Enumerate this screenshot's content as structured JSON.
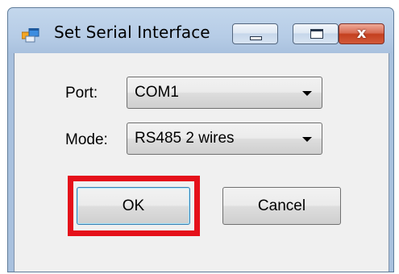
{
  "window": {
    "title": "Set Serial Interface",
    "icon": "app-window-icon",
    "caption_buttons": [
      "minimize-icon",
      "maximize-icon",
      "close-icon"
    ],
    "close_glyph": "x"
  },
  "form": {
    "port": {
      "label": "Port:",
      "value": "COM1"
    },
    "mode": {
      "label": "Mode:",
      "value": "RS485 2 wires"
    }
  },
  "buttons": {
    "ok_label": "OK",
    "cancel_label": "Cancel"
  },
  "colors": {
    "highlight": "#e5101a",
    "titlebar": "#b6cce6",
    "client": "#f0f0f0"
  }
}
